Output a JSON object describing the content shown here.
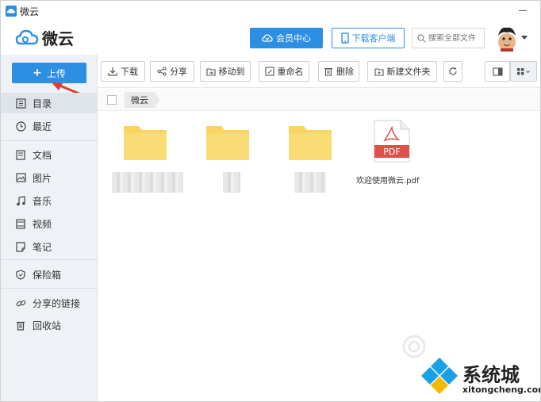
{
  "window": {
    "title": "微云"
  },
  "header": {
    "logo_text": "微云",
    "vip_label": "会员中心",
    "client_label": "下载客户端",
    "search_placeholder": "搜索全部文件"
  },
  "sidebar": {
    "upload_label": "上传",
    "groups": [
      [
        {
          "label": "目录",
          "icon": "catalog-icon"
        },
        {
          "label": "最近",
          "icon": "clock-icon"
        }
      ],
      [
        {
          "label": "文档",
          "icon": "doc-icon"
        },
        {
          "label": "图片",
          "icon": "image-icon"
        },
        {
          "label": "音乐",
          "icon": "music-icon"
        },
        {
          "label": "视频",
          "icon": "video-icon"
        },
        {
          "label": "笔记",
          "icon": "note-icon"
        }
      ],
      [
        {
          "label": "保险箱",
          "icon": "shield-icon"
        }
      ],
      [
        {
          "label": "分享的链接",
          "icon": "link-icon"
        },
        {
          "label": "回收站",
          "icon": "trash-icon"
        }
      ]
    ]
  },
  "toolbar": {
    "buttons": [
      {
        "label": "下载",
        "icon": "download-icon"
      },
      {
        "label": "分享",
        "icon": "share-icon"
      },
      {
        "label": "移动到",
        "icon": "move-icon"
      },
      {
        "label": "重命名",
        "icon": "rename-icon"
      },
      {
        "label": "删除",
        "icon": "delete-icon"
      },
      {
        "label": "新建文件夹",
        "icon": "new-folder-icon"
      }
    ],
    "refresh_icon": "refresh-icon",
    "view_icons": [
      "list-view-icon",
      "grid-view-icon"
    ]
  },
  "breadcrumb": {
    "root": "微云"
  },
  "files": [
    {
      "type": "folder"
    },
    {
      "type": "folder"
    },
    {
      "type": "folder"
    },
    {
      "type": "pdf",
      "name": "欢迎使用微云.pdf",
      "badge": "PDF"
    }
  ],
  "watermark": {
    "brand": "系统城",
    "url": "xitongcheng.com"
  },
  "colors": {
    "accent": "#2d8fe3",
    "folder": "#f7d560",
    "pdf_red": "#e0504a"
  }
}
